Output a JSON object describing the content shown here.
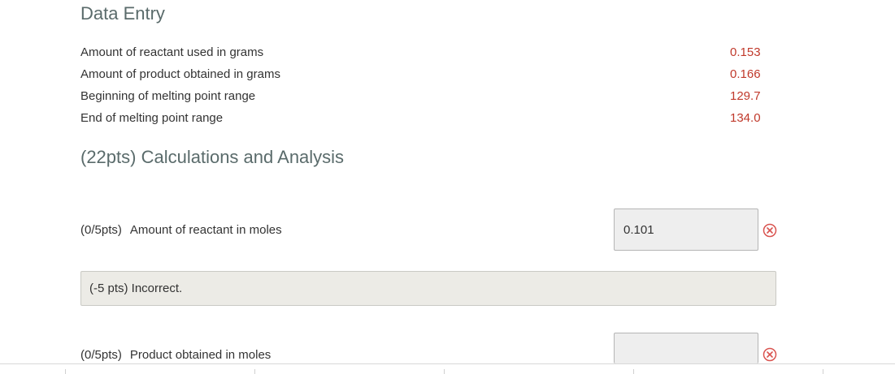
{
  "data_entry": {
    "title": "Data Entry",
    "rows": [
      {
        "label": "Amount of reactant used in grams",
        "value": "0.153"
      },
      {
        "label": "Amount of product obtained in grams",
        "value": "0.166"
      },
      {
        "label": "Beginning of melting point range",
        "value": "129.7"
      },
      {
        "label": "End of melting point range",
        "value": "134.0"
      }
    ]
  },
  "analysis": {
    "title": "(22pts) Calculations and Analysis",
    "questions": [
      {
        "points": "(0/5pts)",
        "label": "Amount of reactant in moles",
        "answer": "0.101",
        "status_icon": "error-circle-x-icon"
      },
      {
        "points": "(0/5pts)",
        "label": "Product obtained in moles",
        "answer": "",
        "status_icon": "error-circle-x-icon"
      }
    ],
    "feedback": "(-5 pts) Incorrect."
  },
  "colors": {
    "heading": "#5a6b6b",
    "value_red": "#c0392b",
    "error_icon": "#d9534f",
    "input_bg": "#eeeeee",
    "feedback_bg": "#ecebe6"
  }
}
